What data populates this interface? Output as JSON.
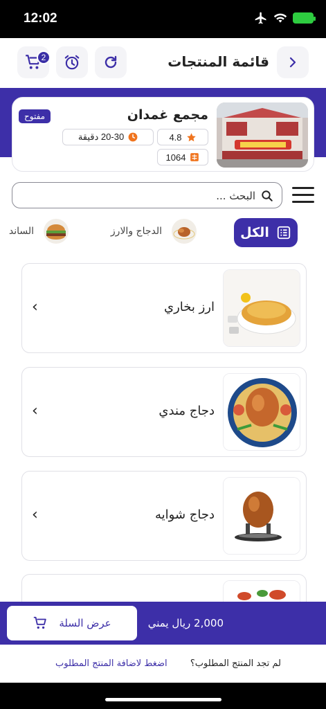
{
  "status_bar": {
    "time": "12:02"
  },
  "header": {
    "title": "قائمة المنتجات",
    "cart_count": "2"
  },
  "store": {
    "name": "مجمع غمدان",
    "status": "مفتوح",
    "rating": "4.8",
    "delivery_time": "20-30 دقيقة",
    "orders": "1064"
  },
  "search": {
    "placeholder": "البحث ..."
  },
  "categories": {
    "all_label": "الكل",
    "items": [
      {
        "label": "الدجاج والارز"
      },
      {
        "label": "الساند"
      }
    ]
  },
  "products": [
    {
      "name": "ارز بخاري"
    },
    {
      "name": "دجاج مندي"
    },
    {
      "name": "دجاج شوايه"
    },
    {
      "name": ""
    }
  ],
  "cart_bar": {
    "total": "2,000 ريال يمني",
    "view_cart_label": "عرض السلة"
  },
  "footer": {
    "question": "لم تجد المنتج المطلوب؟",
    "link": "اضغط لاضافة المنتج المطلوب"
  },
  "colors": {
    "primary": "#3d2fa8",
    "battery": "#2ecc40",
    "star": "#f0741e"
  }
}
